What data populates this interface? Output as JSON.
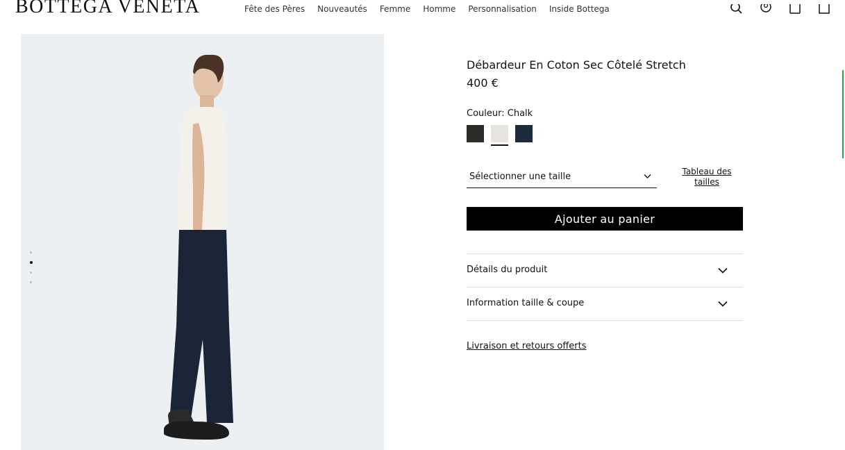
{
  "brand": {
    "logo_text": "BOTTEGA VENETA"
  },
  "nav": {
    "items": [
      "Fête des Pères",
      "Nouveautés",
      "Femme",
      "Homme",
      "Personnalisation",
      "Inside Bottega"
    ]
  },
  "header_icons": [
    "search-icon",
    "account-icon",
    "wishlist-icon",
    "bag-icon"
  ],
  "gallery": {
    "image_count": 4,
    "active_index": 2
  },
  "product": {
    "title": "Débardeur En Coton Sec Côtelé Stretch",
    "price": "400 €",
    "color_label": "Couleur: Chalk",
    "swatches": [
      {
        "name": "dark olive",
        "color": "#2b2b27",
        "selected": false
      },
      {
        "name": "Chalk",
        "color": "#e6e4dc",
        "selected": true
      },
      {
        "name": "navy",
        "color": "#1d2a3c",
        "selected": false
      }
    ],
    "size_placeholder": "Sélectionner une taille",
    "size_guide": "Tableau des tailles",
    "add_to_cart": "Ajouter au panier",
    "accordion": [
      "Détails du produit",
      "Information taille & coupe"
    ],
    "shipping_link": "Livraison et retours offerts"
  },
  "colors": {
    "accent_scroll": "#2e9e4f",
    "button_bg": "#000000",
    "image_bg": "#edf0f3"
  }
}
